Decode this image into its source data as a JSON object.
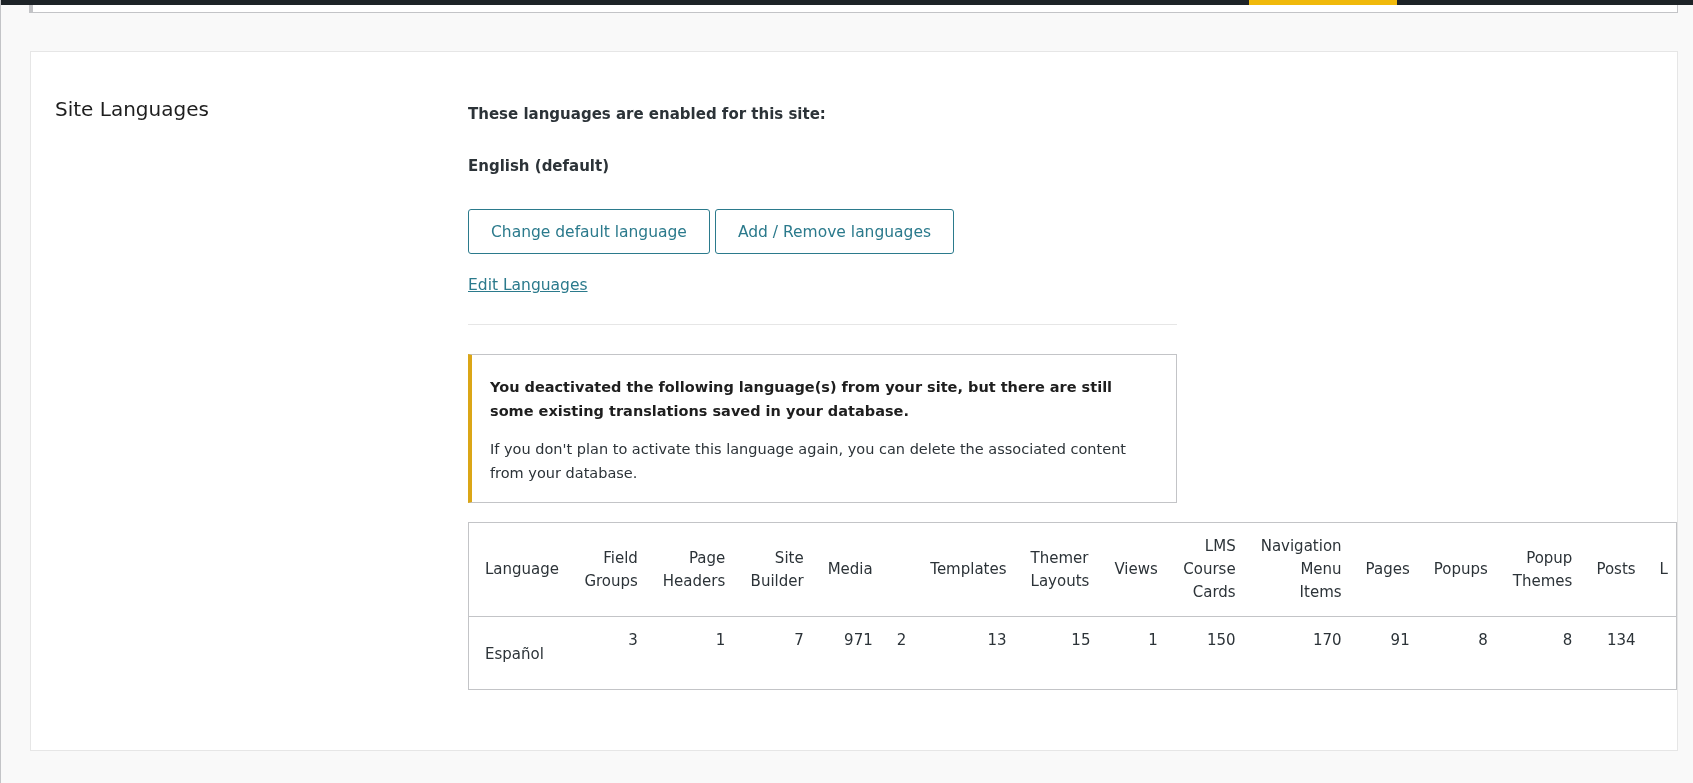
{
  "section": {
    "title": "Site Languages"
  },
  "enabled_intro": "These languages are enabled for this site:",
  "languages": [
    {
      "label": "English (default)"
    }
  ],
  "buttons": [
    {
      "label": "Change default language"
    },
    {
      "label": "Add / Remove languages"
    }
  ],
  "edit_link": "Edit Languages",
  "notice": {
    "heading": "You deactivated the following language(s) from your site, but there are still some existing translations saved in your database.",
    "body": "If you don't plan to activate this language again, you can delete the associated content from your database."
  },
  "table": {
    "columns": [
      "Language",
      "Field Groups",
      "Page Headers",
      "Site Builder",
      "Media",
      null,
      "Templates",
      "Themer Layouts",
      "Views",
      "LMS Course Cards",
      "Navigation Menu Items",
      "Pages",
      "Popups",
      "Popup Themes",
      "Posts",
      "L"
    ],
    "rows": [
      [
        "Español",
        "3",
        "1",
        "7",
        "971",
        "2",
        "13",
        "15",
        "1",
        "150",
        "170",
        "91",
        "8",
        "8",
        "134",
        null
      ]
    ]
  }
}
